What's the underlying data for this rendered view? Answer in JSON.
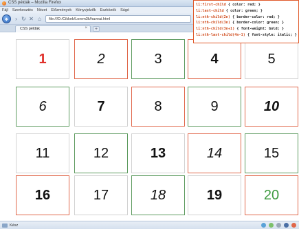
{
  "window": {
    "title": "CSS példák – Mozilla Firefox"
  },
  "menu": [
    "Fájl",
    "Szerkesztés",
    "Nézet",
    "Előzmények",
    "Könyvjelzők",
    "Eszközök",
    "Súgó"
  ],
  "navbar": {
    "url": "file:///D:/Cikkek/Lorem3k/haveai.html"
  },
  "tab": {
    "label": "CSS példák",
    "close": "×",
    "new_tab": "+"
  },
  "code": {
    "lines": [
      {
        "selector": "li:first-child",
        "rule": " { color: red; }"
      },
      {
        "selector": "li:last-child",
        "rule": "  { color: green; }"
      },
      {
        "selector": "li:nth-child(2n)",
        "rule": " { border-color: red; }"
      },
      {
        "selector": "li:nth-child(3n)",
        "rule": " { border-color: green; }"
      },
      {
        "selector": "li:nth-child(3n+1)",
        "rule": " { font-weight: bold; }"
      },
      {
        "selector": "li:nth-last-child(4n-1)",
        "rule": " { font-style: italic; }"
      }
    ]
  },
  "cells": [
    "1",
    "2",
    "3",
    "4",
    "5",
    "6",
    "7",
    "8",
    "9",
    "10",
    "11",
    "12",
    "13",
    "14",
    "15",
    "16",
    "17",
    "18",
    "19",
    "20"
  ],
  "status": {
    "text": "Kész"
  },
  "colors": {
    "red": "#e0302a",
    "green": "#3d9a3f",
    "border_red": "#e0674a",
    "border_green": "#5c9a5e"
  }
}
